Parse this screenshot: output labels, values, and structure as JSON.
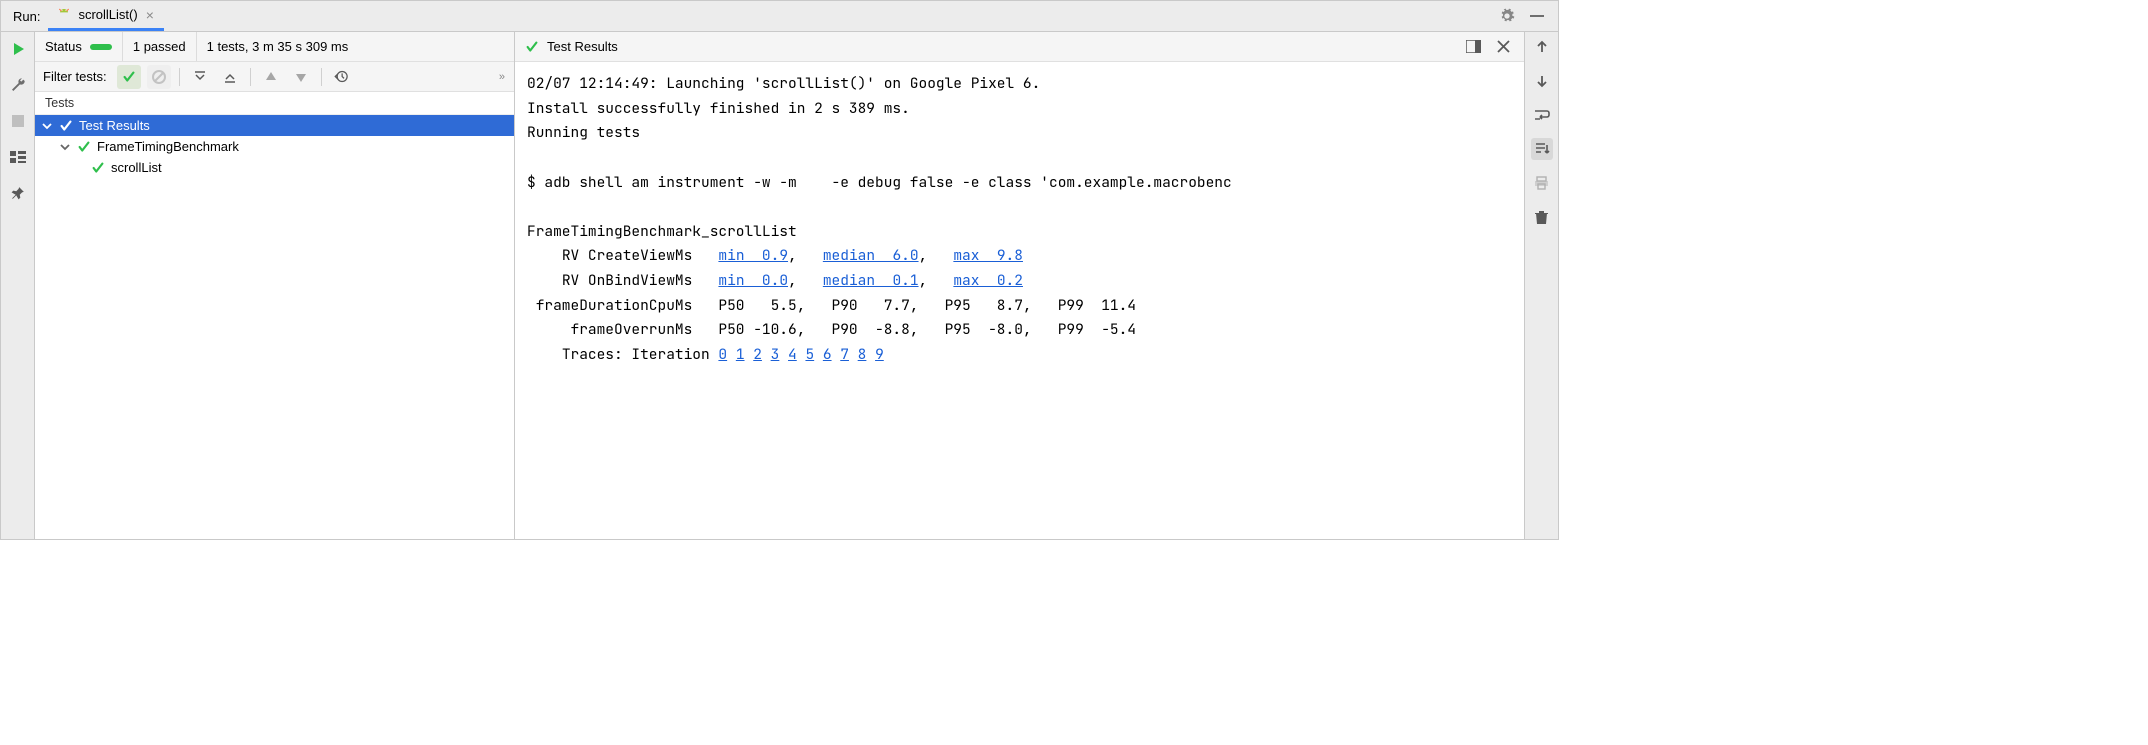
{
  "run_label": "Run:",
  "tab": {
    "name": "scrollList()"
  },
  "status": {
    "label": "Status",
    "passed": "1 passed",
    "total": "1 tests, 3 m 35 s 309 ms"
  },
  "filter": {
    "label": "Filter tests:"
  },
  "tree": {
    "header": "Tests",
    "root": "Test Results",
    "class": "FrameTimingBenchmark",
    "test": "scrollList"
  },
  "right_header": "Test Results",
  "console": {
    "launch": "02/07 12:14:49: Launching 'scrollList()' on Google Pixel 6.",
    "install": "Install successfully finished in 2 s 389 ms.",
    "running": "Running tests",
    "cmd": "$ adb shell am instrument -w -m    -e debug false -e class 'com.example.macrobenc",
    "bench_title": "FrameTimingBenchmark_scrollList",
    "row1_label": "RV CreateViewMs",
    "row1_min": "min  0.9",
    "row1_med": "median  6.0",
    "row1_max": "max  9.8",
    "row2_label": "RV OnBindViewMs",
    "row2_min": "min  0.0",
    "row2_med": "median  0.1",
    "row2_max": "max  0.2",
    "row3": " frameDurationCpuMs   P50   5.5,   P90   7.7,   P95   8.7,   P99  11.4",
    "row4": "     frameOverrunMs   P50 -10.6,   P90  -8.8,   P95  -8.0,   P99  -5.4",
    "traces_label": "Traces: Iteration",
    "iters": [
      "0",
      "1",
      "2",
      "3",
      "4",
      "5",
      "6",
      "7",
      "8",
      "9"
    ]
  }
}
